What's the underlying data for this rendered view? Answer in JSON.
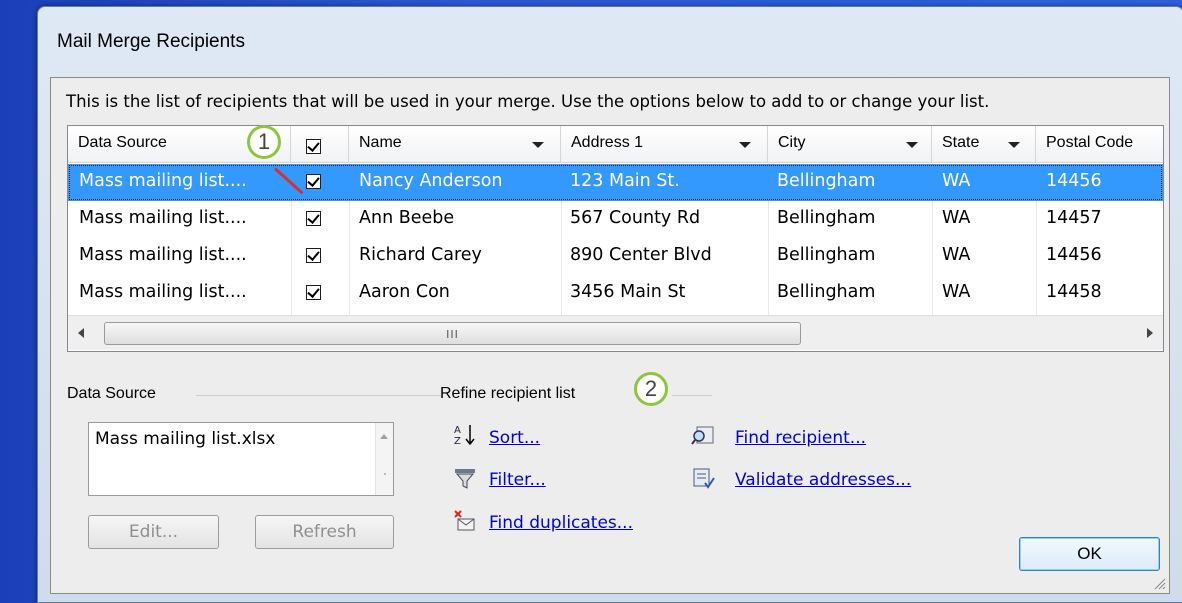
{
  "window": {
    "title": "Mail Merge Recipients"
  },
  "intro_text": "This is the list of recipients that will be used in your merge.  Use the options below to add to or change your list.",
  "grid": {
    "columns": [
      "Data Source",
      "",
      "Name",
      "Address 1",
      "City",
      "State",
      "Postal Code"
    ],
    "rows": [
      {
        "source": "Mass mailing list....",
        "checked": true,
        "name": "Nancy Anderson",
        "address": "123 Main St.",
        "city": "Bellingham",
        "state": "WA",
        "postal": "14456",
        "selected": true
      },
      {
        "source": "Mass mailing list....",
        "checked": true,
        "name": "Ann Beebe",
        "address": "567 County Rd",
        "city": "Bellingham",
        "state": "WA",
        "postal": "14457",
        "selected": false
      },
      {
        "source": "Mass mailing list....",
        "checked": true,
        "name": "Richard Carey",
        "address": "890 Center Blvd",
        "city": "Bellingham",
        "state": "WA",
        "postal": "14456",
        "selected": false
      },
      {
        "source": "Mass mailing list....",
        "checked": true,
        "name": "Aaron Con",
        "address": "3456 Main St",
        "city": "Bellingham",
        "state": "WA",
        "postal": "14458",
        "selected": false
      }
    ]
  },
  "callouts": [
    "1",
    "2"
  ],
  "data_source": {
    "label": "Data Source",
    "items": [
      "Mass mailing list.xlsx"
    ],
    "edit_label": "Edit...",
    "refresh_label": "Refresh"
  },
  "refine": {
    "label": "Refine recipient list",
    "sort": "Sort...",
    "filter": "Filter...",
    "find_duplicates": "Find duplicates...",
    "find_recipient": "Find recipient...",
    "validate": "Validate addresses..."
  },
  "ok_label": "OK",
  "colors": {
    "selection": "#3399ff",
    "callout_ring": "#8cc63f",
    "pointer": "#d9302c",
    "link": "#0000dd"
  }
}
